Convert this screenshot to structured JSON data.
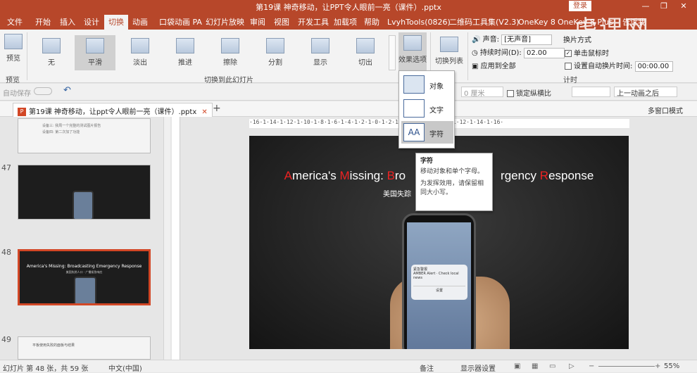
{
  "window": {
    "title": "第19课 神奇移动，让PPT令人眼前一亮（课件）.pptx",
    "login_label": "登录",
    "minimize_label": "—",
    "restore_label": "❐",
    "close_label": "✕"
  },
  "ribbon_tabs": [
    "文件",
    "开始",
    "插入",
    "设计",
    "切换",
    "动画",
    "口袋动画 PA",
    "幻灯片放映",
    "审阅",
    "视图",
    "开发工具",
    "加载项",
    "帮助",
    "LvyhTools(0826)",
    "二维码工具集(V2.3)",
    "OneKey 8",
    "OneKey 8 Plus",
    "告诉我"
  ],
  "active_tab": "切换",
  "watermark": "虎课网",
  "ribbon": {
    "preview_label": "预览",
    "preview_group": "预览",
    "transitions": [
      "无",
      "平滑",
      "淡出",
      "推进",
      "擦除",
      "分割",
      "显示",
      "切出"
    ],
    "selected_transition": "平滑",
    "transition_group": "切换到此幻灯片",
    "effect_options_label": "效果选项",
    "transition_list_label": "切换列表",
    "sound_label": "声音:",
    "sound_value": "[无声音]",
    "duration_label": "持续时间(D):",
    "duration_value": "02.00",
    "apply_all_label": "应用到全部",
    "advance_label": "换片方式",
    "on_click_label": "单击鼠标时",
    "auto_after_label": "设置自动换片时间:",
    "auto_after_value": "00:00.00",
    "timing_group": "计时"
  },
  "qat": {
    "autosave_label": "自动保存",
    "lock_ratio_label": "锁定纵横比",
    "width_value": "0 厘米",
    "prev_anim_label": "上一动画之后"
  },
  "doc_tab": {
    "name": "第19课 神奇移动，让ppt令人眼前一亮（课件）.pptx",
    "multi_window_label": "多窗口模式"
  },
  "ruler_text": "·16·1·14·1·12·1·10·1·8·1·6·1·4·1·2·1·0·1·2·1·4·1·6·1·8·1·10·1·12·1·14·1·16·",
  "thumbnails": [
    {
      "num": "",
      "lines": [
        "设备三: 我周一个完整的测试图片报告",
        "设备四: 第二次加了功能"
      ]
    },
    {
      "num": "47",
      "lines": []
    },
    {
      "num": "48",
      "lines": [
        "America's Missing: Broadcasting Emergency Response",
        "美国失踪人口 · 广播紧急响应"
      ]
    },
    {
      "num": "49",
      "lines": [
        "平板使用失败的面板与结果"
      ]
    }
  ],
  "slide": {
    "title_parts": [
      {
        "text": "A",
        "red": true
      },
      {
        "text": "merica's ",
        "red": false
      },
      {
        "text": "M",
        "red": true
      },
      {
        "text": "issing: ",
        "red": false
      },
      {
        "text": "B",
        "red": true
      },
      {
        "text": "ro",
        "red": false
      },
      {
        "text": "                          ",
        "red": false
      },
      {
        "text": "rgency ",
        "red": false
      },
      {
        "text": "R",
        "red": true
      },
      {
        "text": "esponse",
        "red": false
      }
    ],
    "subtitle": "美国失踪",
    "phone_notif_title": "紧急警报",
    "phone_notif_text": "AMBER Alert · Check local news",
    "phone_notif_btn": "设置"
  },
  "dropdown": {
    "items": [
      "对象",
      "文字",
      "字符"
    ],
    "highlighted": "字符"
  },
  "tooltip": {
    "title": "字符",
    "line1": "移动对象和单个字母。",
    "line2": "为发挥效用，请保留相同大小写。"
  },
  "status": {
    "slide_info": "幻灯片 第 48 张，共 59 张",
    "language": "中文(中国)",
    "notes_label": "备注",
    "display_label": "显示器设置",
    "zoom": "55%"
  },
  "colors": {
    "accent": "#b7472a",
    "highlight_red": "#e22222"
  }
}
